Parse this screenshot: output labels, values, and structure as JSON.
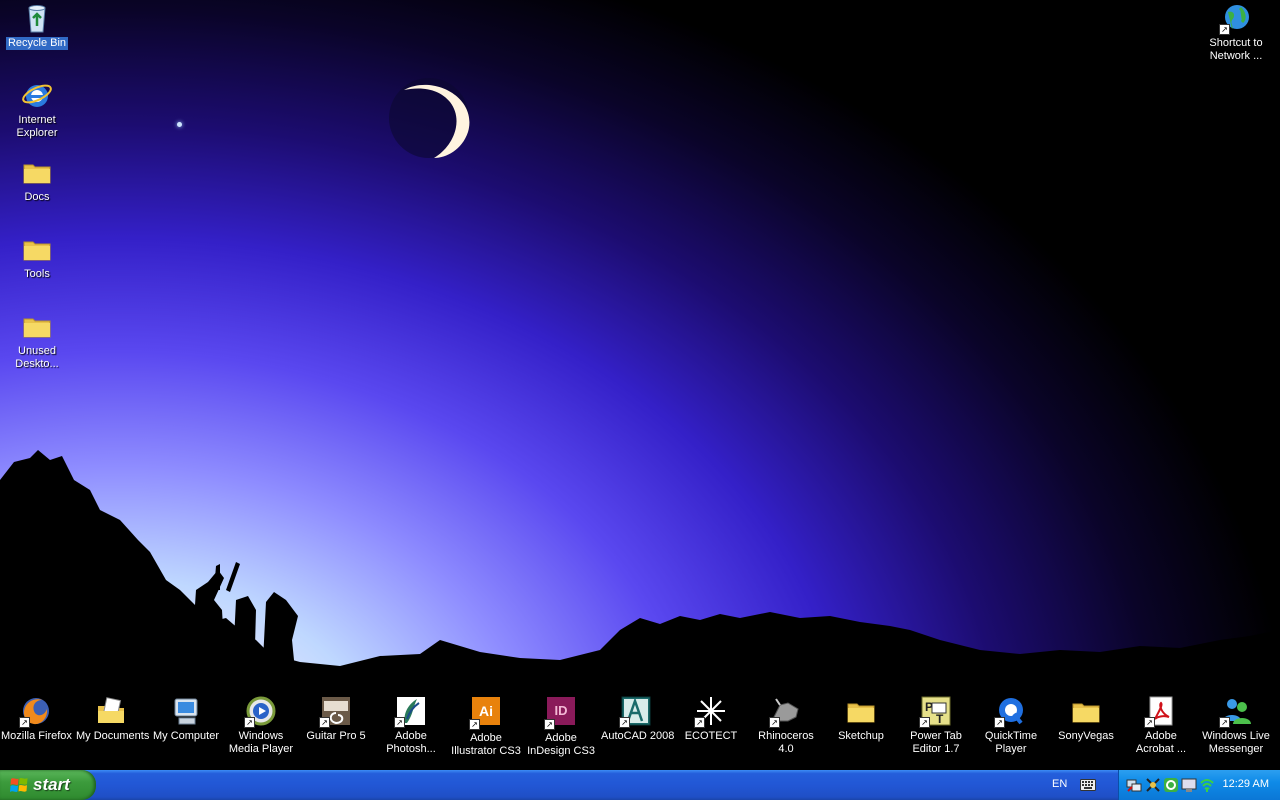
{
  "desktop": {
    "left_icons": [
      {
        "label": "Recycle Bin",
        "icon": "recycle-bin-icon",
        "selected": true
      },
      {
        "label": "Internet\nExplorer",
        "icon": "internet-explorer-icon"
      },
      {
        "label": "Docs",
        "icon": "folder-icon"
      },
      {
        "label": "Tools",
        "icon": "folder-icon"
      },
      {
        "label": "Unused\nDeskto...",
        "icon": "folder-icon"
      }
    ],
    "right_icon": {
      "label": "Shortcut to\nNetwork ...",
      "icon": "network-globe-icon"
    },
    "bottom_icons": [
      {
        "label": "Mozilla Firefox",
        "icon": "firefox-icon"
      },
      {
        "label": "My Documents",
        "icon": "my-documents-icon"
      },
      {
        "label": "My Computer",
        "icon": "my-computer-icon"
      },
      {
        "label": "Windows\nMedia Player",
        "icon": "media-player-icon"
      },
      {
        "label": "Guitar Pro 5",
        "icon": "guitar-pro-icon"
      },
      {
        "label": "Adobe\nPhotosh...",
        "icon": "photoshop-icon"
      },
      {
        "label": "Adobe\nIllustrator CS3",
        "icon": "illustrator-icon"
      },
      {
        "label": "Adobe\nInDesign CS3",
        "icon": "indesign-icon"
      },
      {
        "label": "AutoCAD 2008",
        "icon": "autocad-icon"
      },
      {
        "label": "ECOTECT",
        "icon": "ecotect-icon"
      },
      {
        "label": "Rhinoceros\n4.0",
        "icon": "rhinoceros-icon"
      },
      {
        "label": "Sketchup",
        "icon": "folder-icon"
      },
      {
        "label": "Power Tab\nEditor 1.7",
        "icon": "power-tab-icon"
      },
      {
        "label": "QuickTime\nPlayer",
        "icon": "quicktime-icon"
      },
      {
        "label": "SonyVegas",
        "icon": "folder-icon"
      },
      {
        "label": "Adobe\nAcrobat ...",
        "icon": "acrobat-icon"
      },
      {
        "label": "Windows Live\nMessenger",
        "icon": "messenger-icon"
      }
    ],
    "illustrator_text": "Ai",
    "indesign_text": "ID"
  },
  "taskbar": {
    "start_label": "start",
    "language": "EN",
    "clock": "12:29 AM",
    "tray_icons": [
      "network-tray-icon",
      "antivirus-tray-icon",
      "green-tray-icon",
      "monitor-tray-icon",
      "wireless-tray-icon"
    ]
  },
  "colors": {
    "taskbar": "#245edb",
    "start": "#3c9b3c",
    "tray": "#0f8be8",
    "selection": "#316ac5"
  }
}
